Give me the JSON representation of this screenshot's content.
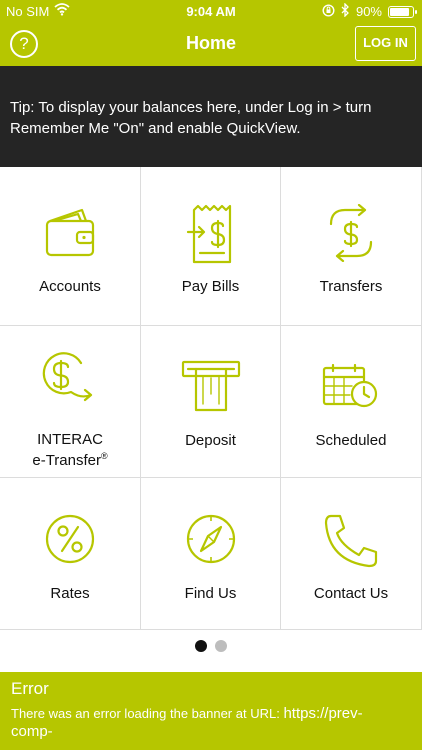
{
  "status_bar": {
    "carrier": "No SIM",
    "time": "9:04 AM",
    "battery": "90%",
    "battery_level": 0.9
  },
  "header": {
    "title": "Home",
    "login_label": "LOG IN",
    "help_glyph": "?"
  },
  "tip": {
    "text": "Tip: To display your balances here, under Log in > turn Remember Me \"On\" and enable QuickView."
  },
  "tiles": [
    {
      "label": "Accounts",
      "icon": "wallet-icon"
    },
    {
      "label": "Pay Bills",
      "icon": "bill-icon"
    },
    {
      "label": "Transfers",
      "icon": "transfer-icon"
    },
    {
      "label_line1": "INTERAC",
      "label_line2": "e-Transfer",
      "label_sup": "®",
      "icon": "etransfer-icon"
    },
    {
      "label": "Deposit",
      "icon": "atm-deposit-icon"
    },
    {
      "label": "Scheduled",
      "icon": "calendar-clock-icon"
    },
    {
      "label": "Rates",
      "icon": "percent-icon"
    },
    {
      "label": "Find Us",
      "icon": "compass-icon"
    },
    {
      "label": "Contact Us",
      "icon": "phone-icon"
    }
  ],
  "pagination": {
    "current": 1,
    "total": 2
  },
  "error_banner": {
    "title": "Error",
    "message": "There was an error loading the banner at URL: ",
    "url_line1": "https://prev-",
    "url_line2": "comp-"
  },
  "colors": {
    "brand": "#b6c600",
    "tip_bg": "#252525",
    "dot_active": "#111111",
    "dot_inactive": "#bdbdbd"
  }
}
